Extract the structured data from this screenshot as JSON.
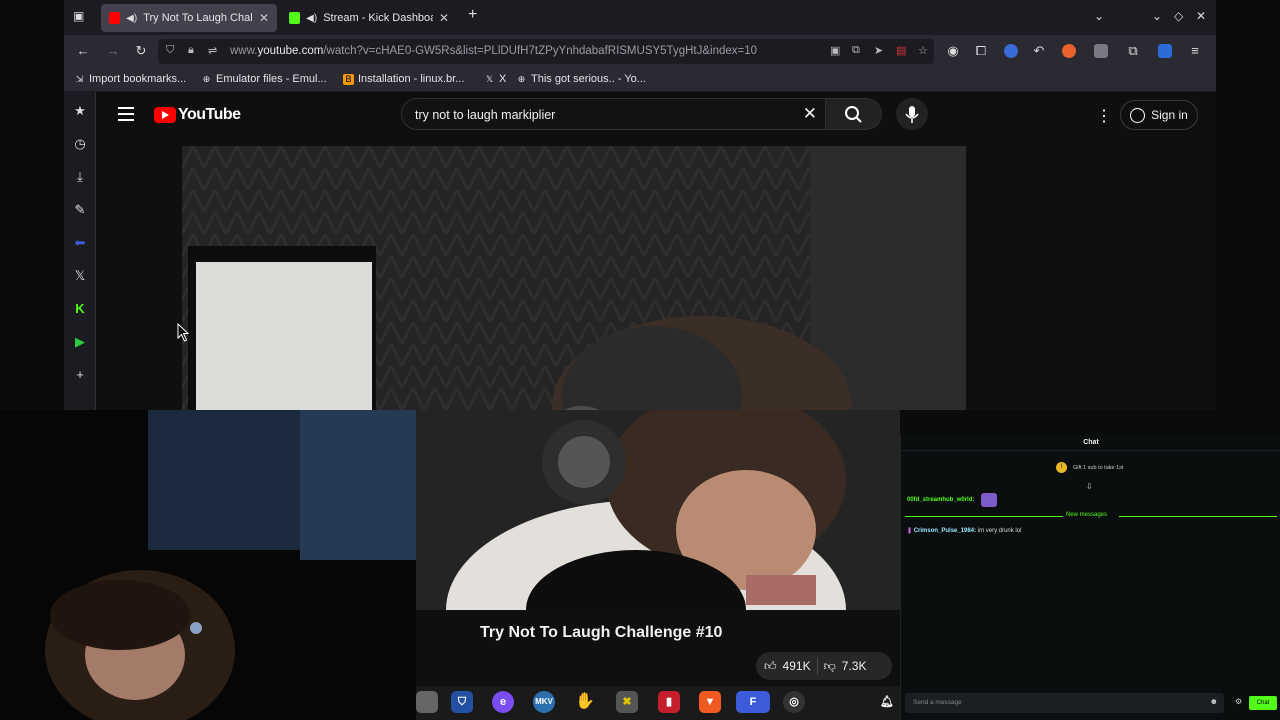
{
  "browser": {
    "tabs": [
      {
        "title": "Try Not To Laugh Challe",
        "icon": "youtube-favicon",
        "color": "#ff0000",
        "active": true
      },
      {
        "title": "Stream - Kick Dashboar",
        "icon": "kick-favicon",
        "color": "#53fc18",
        "active": false
      }
    ],
    "url_prefix": "www.",
    "url_domain": "youtube.com",
    "url_rest": "/watch?v=cHAE0-GW5Rs&list=PLlDUfH7tZPyYnhdabafRISMUSY5TygHtJ&index=10",
    "bookmarks": [
      {
        "label": "Import bookmarks...",
        "icon": "import-icon"
      },
      {
        "label": "Emulator files - Emul...",
        "icon": "globe-icon"
      },
      {
        "label": "Installation - linux.br...",
        "icon": "brave-b-icon"
      },
      {
        "label": "X",
        "icon": "x-icon"
      },
      {
        "label": "This got serious.. - Yo...",
        "icon": "globe-icon"
      }
    ]
  },
  "youtube": {
    "brand": "YouTube",
    "search_value": "try not to laugh markiplier",
    "signin_label": "Sign in",
    "video_title": "Try Not To Laugh Challenge #10",
    "likes": "491K",
    "dislikes": "7.3K"
  },
  "chat": {
    "title": "Chat",
    "gift_text": "Gift 1 sub to take 1st",
    "user1": "00fd_streamhub_w0rld:",
    "new_messages": "New messages",
    "msg2_user": "Crimson_Pulse_1984:",
    "msg2_text": " im very drunk lol",
    "input_placeholder": "Send a message",
    "send_label": "Chat"
  },
  "colors": {
    "youtube_red": "#ff0000",
    "kick_green": "#53fc18"
  }
}
